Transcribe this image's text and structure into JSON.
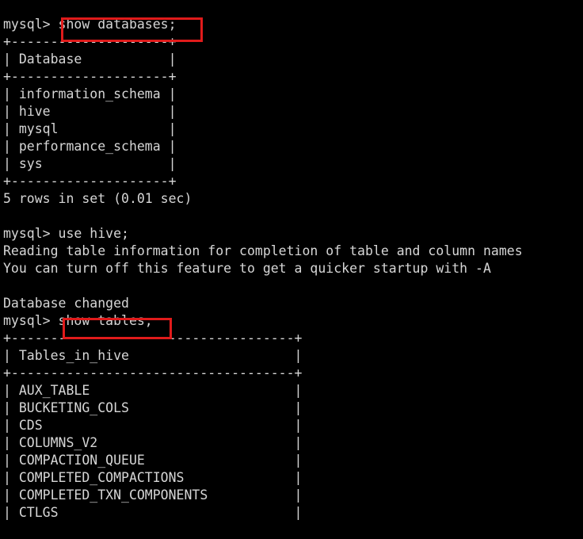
{
  "terminal": {
    "app": "mysql-client-terminal",
    "background_color": "#000000",
    "text_color": "#d6d6d6",
    "annotation_color": "#e01b1b",
    "prompt": "mysql>",
    "lines": [
      "mysql> show databases;",
      "+--------------------+",
      "| Database           |",
      "+--------------------+",
      "| information_schema |",
      "| hive               |",
      "| mysql              |",
      "| performance_schema |",
      "| sys                |",
      "+--------------------+",
      "5 rows in set (0.01 sec)",
      "",
      "mysql> use hive;",
      "Reading table information for completion of table and column names",
      "You can turn off this feature to get a quicker startup with -A",
      "",
      "Database changed",
      "mysql> show tables;",
      "+------------------------------------+",
      "| Tables_in_hive                     |",
      "+------------------------------------+",
      "| AUX_TABLE                          |",
      "| BUCKETING_COLS                     |",
      "| CDS                                |",
      "| COLUMNS_V2                         |",
      "| COMPACTION_QUEUE                   |",
      "| COMPLETED_COMPACTIONS              |",
      "| COMPLETED_TXN_COMPONENTS           |",
      "| CTLGS                              |"
    ],
    "commands": {
      "show_databases": "show databases;",
      "use_hive": "use hive;",
      "show_tables": "show tables;"
    },
    "databases_result": {
      "column_header": "Database",
      "rows": [
        "information_schema",
        "hive",
        "mysql",
        "performance_schema",
        "sys"
      ],
      "status": "5 rows in set (0.01 sec)",
      "row_count": 5,
      "elapsed": "0.01 sec"
    },
    "messages": [
      "Reading table information for completion of table and column names",
      "You can turn off this feature to get a quicker startup with -A",
      "Database changed"
    ],
    "tables_result": {
      "column_header": "Tables_in_hive",
      "rows": [
        "AUX_TABLE",
        "BUCKETING_COLS",
        "CDS",
        "COLUMNS_V2",
        "COMPACTION_QUEUE",
        "COMPLETED_COMPACTIONS",
        "COMPLETED_TXN_COMPONENTS",
        "CTLGS"
      ]
    },
    "annotations": [
      {
        "name": "show-databases-highlight",
        "target": "show databases;"
      },
      {
        "name": "show-tables-highlight",
        "target": "show tables;"
      }
    ]
  }
}
